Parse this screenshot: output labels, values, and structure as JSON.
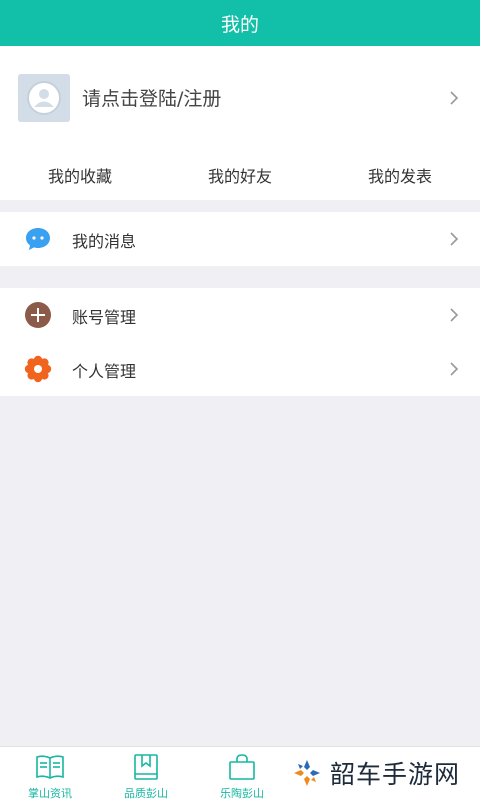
{
  "header": {
    "title": "我的"
  },
  "profile": {
    "login_text": "请点击登陆/注册",
    "shortcuts": [
      "我的收藏",
      "我的好友",
      "我的发表"
    ]
  },
  "menu": {
    "messages": {
      "label": "我的消息",
      "icon": "chat-bubble-icon",
      "color": "#3aa0f0"
    },
    "account": {
      "label": "账号管理",
      "icon": "plus-circle-icon",
      "color": "#8b5a48"
    },
    "personal": {
      "label": "个人管理",
      "icon": "flower-gear-icon",
      "color": "#f0641e"
    }
  },
  "tabbar": {
    "items": [
      {
        "label": "掌山资讯",
        "icon": "open-book-icon"
      },
      {
        "label": "品质彭山",
        "icon": "bookmark-book-icon"
      },
      {
        "label": "乐陶彭山",
        "icon": "shopping-bag-icon"
      }
    ]
  },
  "watermark": {
    "text": "韶车手游网"
  },
  "colors": {
    "accent": "#12bfa8",
    "background": "#efeff4"
  }
}
